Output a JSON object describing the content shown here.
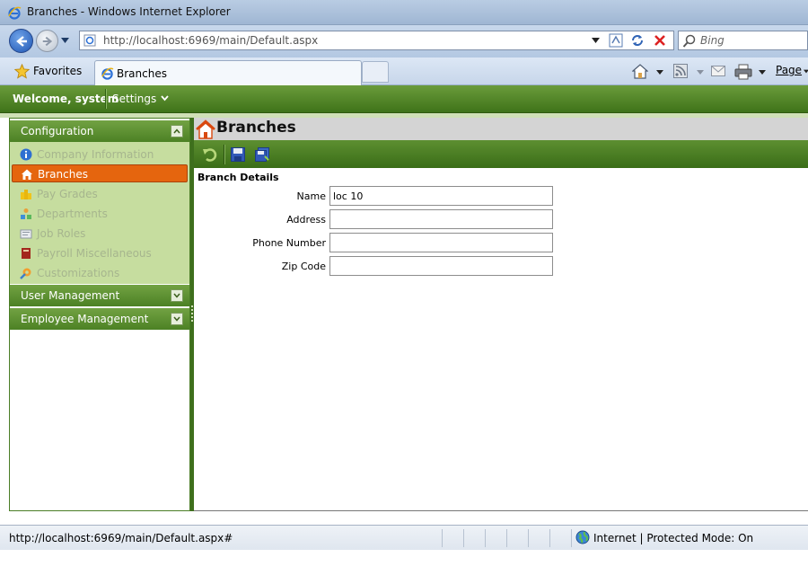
{
  "window": {
    "title": "Branches - Windows Internet Explorer"
  },
  "address_bar": {
    "url": "http://localhost:6969/main/Default.aspx",
    "search_placeholder": "Bing"
  },
  "favorites": {
    "label": "Favorites"
  },
  "tabs": [
    {
      "label": "Branches"
    }
  ],
  "command_bar": {
    "page_label": "Page"
  },
  "app_header": {
    "welcome": "Welcome, system",
    "settings": "Settings"
  },
  "sidebar": {
    "sections": [
      {
        "title": "Configuration",
        "expanded": true,
        "items": [
          {
            "label": "Company Information",
            "icon": "info-icon",
            "active": false
          },
          {
            "label": "Branches",
            "icon": "home-icon",
            "active": true
          },
          {
            "label": "Pay Grades",
            "icon": "pay-grades-icon",
            "active": false
          },
          {
            "label": "Departments",
            "icon": "departments-icon",
            "active": false
          },
          {
            "label": "Job Roles",
            "icon": "job-roles-icon",
            "active": false
          },
          {
            "label": "Payroll Miscellaneous",
            "icon": "book-icon",
            "active": false
          },
          {
            "label": "Customizations",
            "icon": "customizations-icon",
            "active": false
          }
        ]
      },
      {
        "title": "User Management",
        "expanded": false
      },
      {
        "title": "Employee Management",
        "expanded": false
      }
    ]
  },
  "content": {
    "page_title": "Branches",
    "toolbar": {
      "buttons": [
        "undo-icon",
        "save-icon",
        "save-all-icon"
      ]
    },
    "section_title": "Branch Details",
    "fields": [
      {
        "label": "Name",
        "value": "loc 10"
      },
      {
        "label": "Address",
        "value": ""
      },
      {
        "label": "Phone Number",
        "value": ""
      },
      {
        "label": "Zip Code",
        "value": ""
      }
    ]
  },
  "status_bar": {
    "url": "http://localhost:6969/main/Default.aspx#",
    "zone": "Internet | Protected Mode: On"
  },
  "colors": {
    "header_green": "#4c8124",
    "active_orange": "#e5650e",
    "sidebar_bg": "#c6dd9f"
  }
}
